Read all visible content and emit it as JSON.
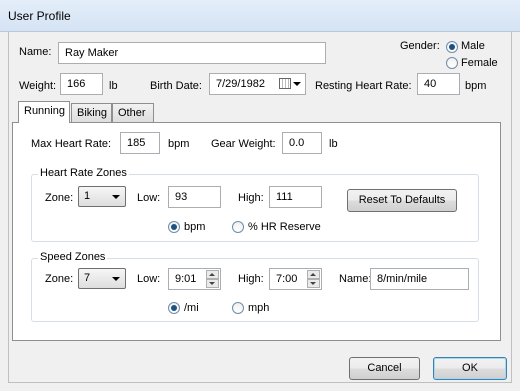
{
  "window": {
    "title": "User Profile"
  },
  "profile": {
    "name_label": "Name:",
    "name_value": "Ray Maker",
    "gender_label": "Gender:",
    "gender_male": "Male",
    "gender_female": "Female",
    "gender_selected": "Male",
    "weight_label": "Weight:",
    "weight_value": "166",
    "weight_unit": "lb",
    "birth_label": "Birth Date:",
    "birth_value": "7/29/1982",
    "rhr_label": "Resting Heart Rate:",
    "rhr_value": "40",
    "rhr_unit": "bpm"
  },
  "tabs": [
    {
      "label": "Running",
      "active": true
    },
    {
      "label": "Biking",
      "active": false
    },
    {
      "label": "Other",
      "active": false
    }
  ],
  "running": {
    "maxhr_label": "Max Heart Rate:",
    "maxhr_value": "185",
    "maxhr_unit": "bpm",
    "gear_label": "Gear Weight:",
    "gear_value": "0.0",
    "gear_unit": "lb"
  },
  "hr_zones": {
    "title": "Heart Rate Zones",
    "zone_label": "Zone:",
    "zone_value": "1",
    "low_label": "Low:",
    "low_value": "93",
    "high_label": "High:",
    "high_value": "111",
    "reset_button": "Reset To Defaults",
    "unit_bpm": "bpm",
    "unit_reserve": "% HR Reserve",
    "unit_selected": "bpm"
  },
  "speed_zones": {
    "title": "Speed Zones",
    "zone_label": "Zone:",
    "zone_value": "7",
    "low_label": "Low:",
    "low_value": "9:01",
    "high_label": "High:",
    "high_value": "7:00",
    "name_label": "Name:",
    "name_value": "8/min/mile",
    "unit_mi": "/mi",
    "unit_mph": "mph",
    "unit_selected": "/mi"
  },
  "footer": {
    "cancel": "Cancel",
    "ok": "OK"
  }
}
